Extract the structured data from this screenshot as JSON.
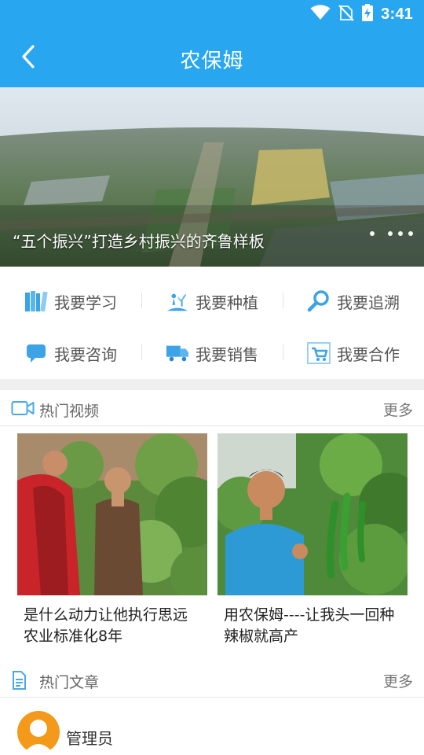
{
  "status_bar": {
    "time": "3:41",
    "icons": [
      "wifi-icon",
      "no-sim-icon",
      "battery-charging-icon"
    ]
  },
  "app_bar": {
    "title": "农保姆",
    "back_icon": "back-arrow-icon"
  },
  "banner": {
    "caption": "“五个振兴”打造乡村振兴的齐鲁样板",
    "page_count": 4,
    "active_index": 0
  },
  "quick_menu": {
    "rows": [
      [
        {
          "label": "我要学习",
          "icon": "books-icon"
        },
        {
          "label": "我要种植",
          "icon": "planting-icon"
        },
        {
          "label": "我要追溯",
          "icon": "magnifier-icon"
        }
      ],
      [
        {
          "label": "我要咨询",
          "icon": "chat-bubble-icon"
        },
        {
          "label": "我要销售",
          "icon": "truck-icon"
        },
        {
          "label": "我要合作",
          "icon": "shopping-cart-icon"
        }
      ]
    ]
  },
  "hot_videos": {
    "title": "热门视频",
    "more": "更多",
    "icon": "video-camera-icon",
    "items": [
      {
        "title": "是什么动力让他执行思远农业标准化8年"
      },
      {
        "title": "用农保姆----让我头一回种辣椒就高产"
      }
    ]
  },
  "hot_articles": {
    "title": "热门文章",
    "more": "更多",
    "icon": "document-icon",
    "items": [
      {
        "author": "管理员"
      }
    ]
  },
  "colors": {
    "primary": "#28a7f0",
    "icon_blue": "#3ba3e6",
    "avatar_orange": "#f39a1b"
  }
}
